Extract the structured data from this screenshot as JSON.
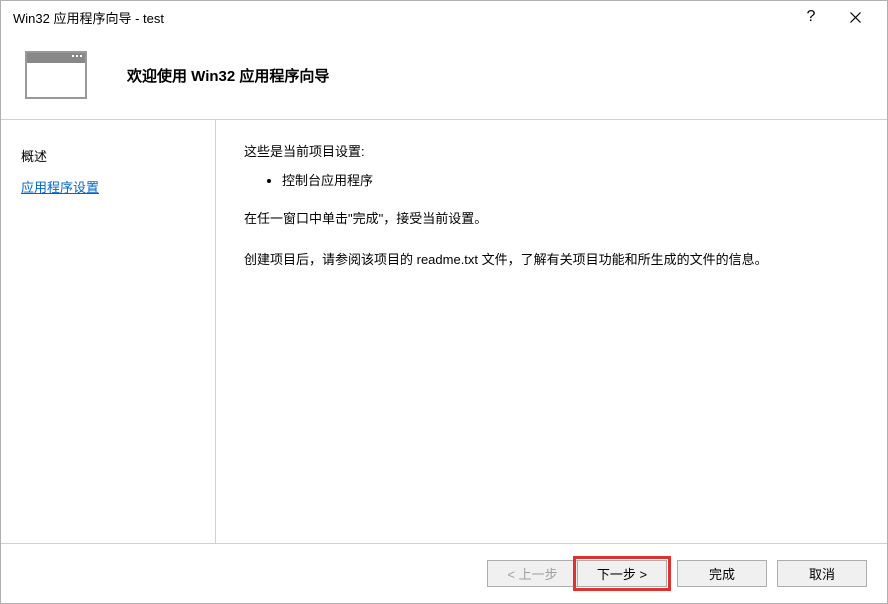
{
  "window": {
    "title": "Win32 应用程序向导 - test"
  },
  "header": {
    "title": "欢迎使用 Win32 应用程序向导"
  },
  "sidebar": {
    "items": [
      {
        "label": "概述"
      },
      {
        "label": "应用程序设置"
      }
    ]
  },
  "main": {
    "intro": "这些是当前项目设置:",
    "bullets": [
      "控制台应用程序"
    ],
    "para1": "在任一窗口中单击\"完成\"，接受当前设置。",
    "para2": "创建项目后，请参阅该项目的 readme.txt 文件，了解有关项目功能和所生成的文件的信息。"
  },
  "footer": {
    "prev": "< 上一步",
    "next": "下一步 >",
    "finish": "完成",
    "cancel": "取消"
  }
}
